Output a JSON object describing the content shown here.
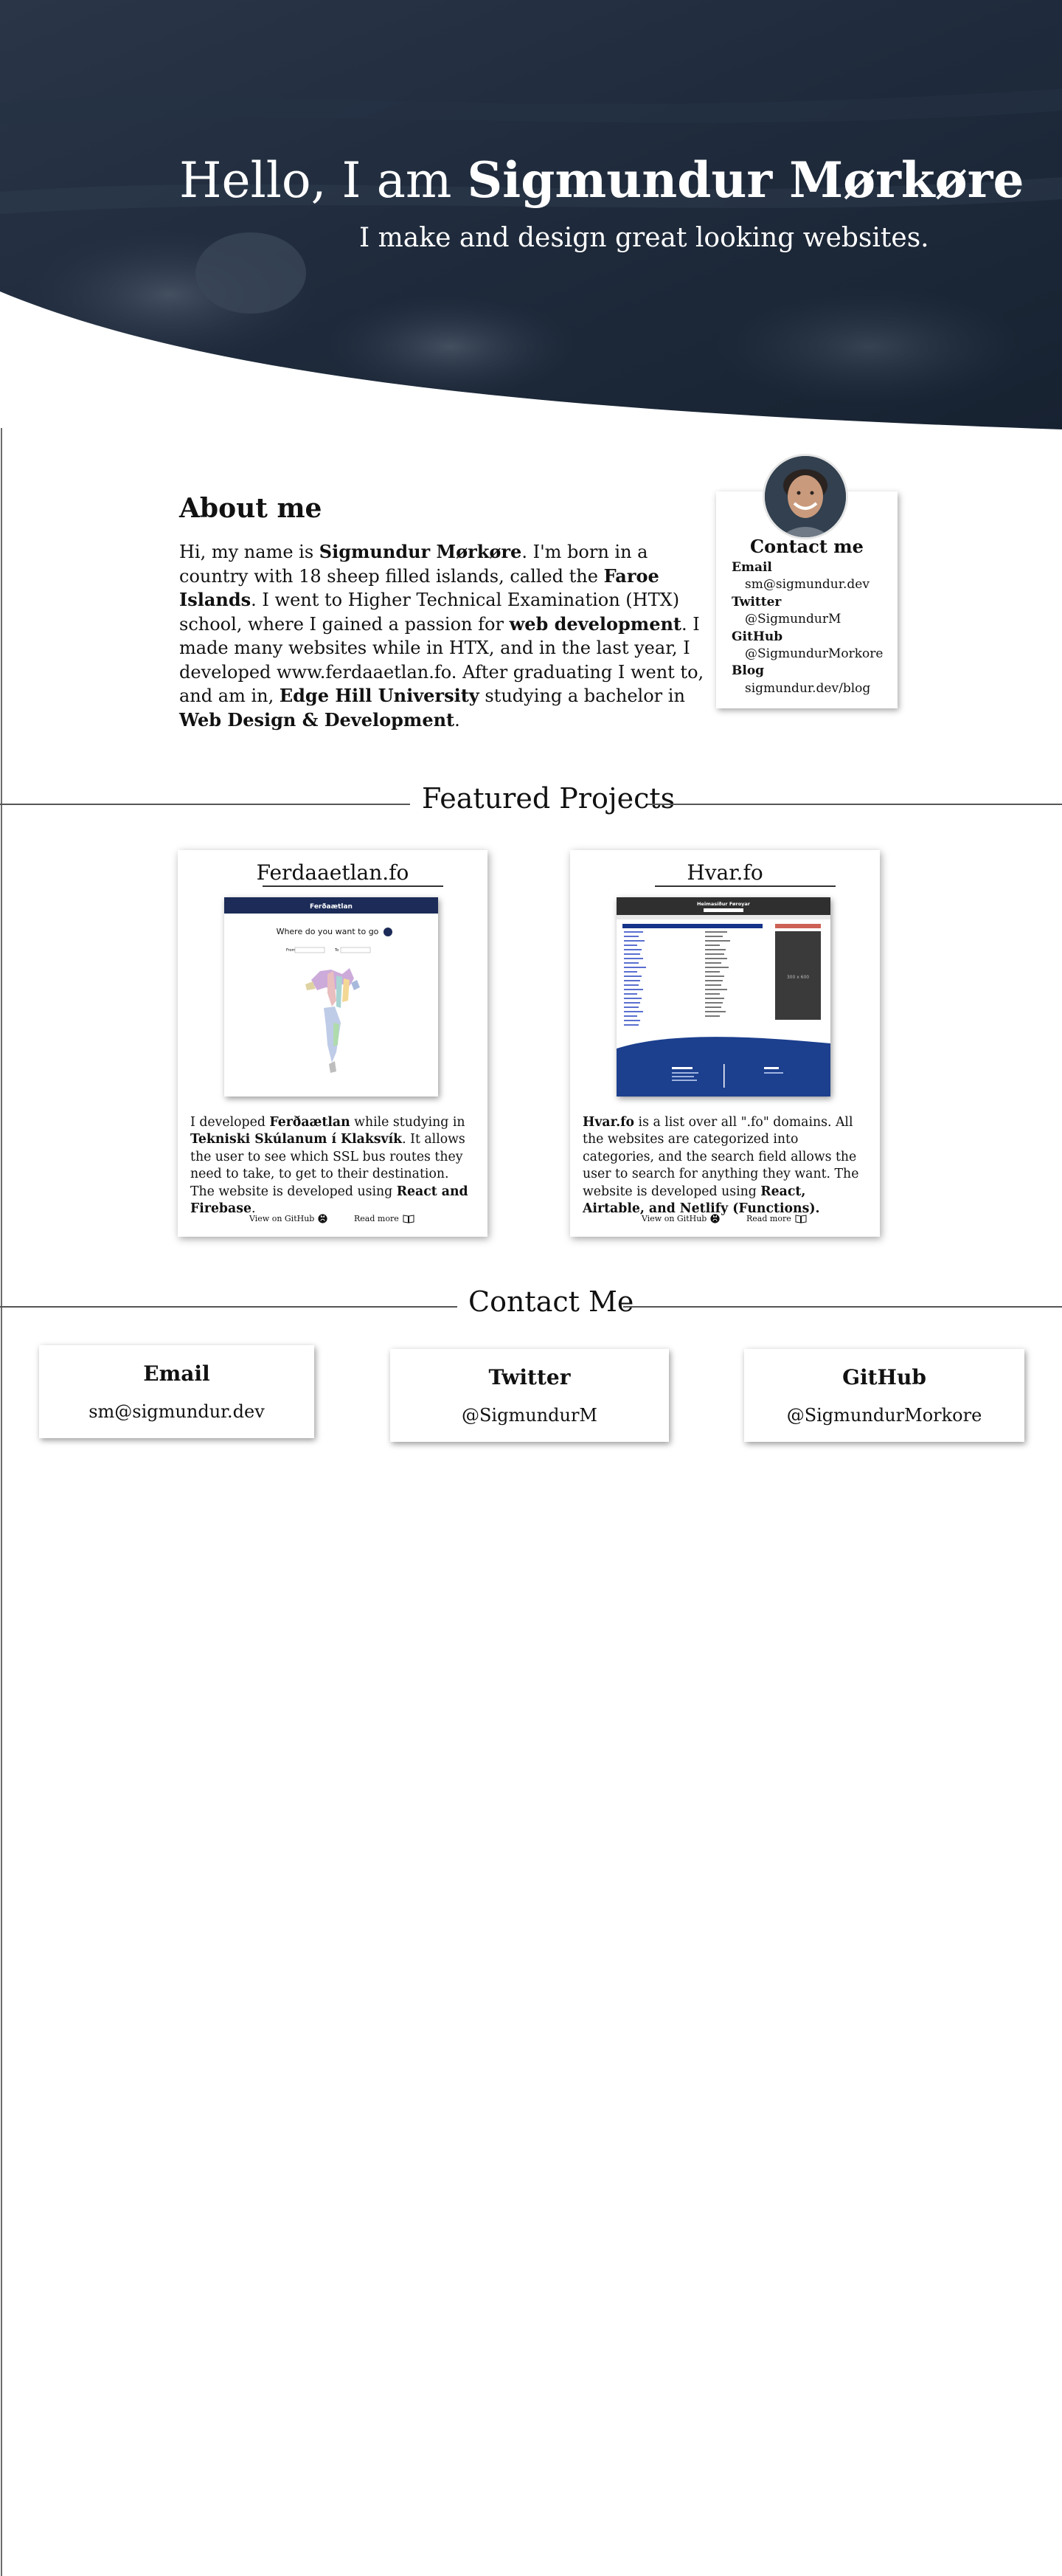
{
  "hero": {
    "greeting": "Hello, I am ",
    "name": "Sigmundur Mørkøre",
    "subtitle": "I make and design great looking websites."
  },
  "about": {
    "heading": "About me",
    "paragraph": [
      {
        "t": "Hi, my name is "
      },
      {
        "t": "Sigmundur Mørkøre",
        "b": true
      },
      {
        "t": ". I'm born in a country with 18 sheep filled islands, called the "
      },
      {
        "t": "Faroe Islands",
        "b": true
      },
      {
        "t": ". I went to Higher Technical Examination (HTX) school, where I gained a passion for "
      },
      {
        "t": "web development",
        "b": true
      },
      {
        "t": ". I made many websites while in HTX, and in the last year, I developed www.ferdaaetlan.fo. After graduating I went to, and am in, "
      },
      {
        "t": "Edge Hill University",
        "b": true
      },
      {
        "t": " studying a bachelor in "
      },
      {
        "t": "Web Design & Development",
        "b": true
      },
      {
        "t": "."
      }
    ]
  },
  "contact_card": {
    "title": "Contact me",
    "items": [
      {
        "label": "Email",
        "value": "sm@sigmundur.dev"
      },
      {
        "label": "Twitter",
        "value": "@SigmundurM"
      },
      {
        "label": "GitHub",
        "value": "@SigmundurMorkore"
      },
      {
        "label": "Blog",
        "value": "sigmundur.dev/blog"
      }
    ]
  },
  "projects": {
    "heading": "Featured Projects",
    "items": [
      {
        "title": "Ferdaaetlan.fo",
        "desc": [
          {
            "t": "I developed "
          },
          {
            "t": "Ferðaætlan",
            "b": true
          },
          {
            "t": " while studying in "
          },
          {
            "t": "Tekniski Skúlanum í Klaksvík",
            "b": true
          },
          {
            "t": ". It allows the user to see which SSL bus routes they need to take, to get to their destination. The website is developed using "
          },
          {
            "t": "React and Firebase",
            "b": true
          },
          {
            "t": "."
          }
        ],
        "github_label": "View on GitHub",
        "read_label": "Read more",
        "shot": {
          "header": "Ferðaætlan",
          "question": "Where do you want to go",
          "from_label": "From",
          "to_label": "To"
        }
      },
      {
        "title": "Hvar.fo",
        "desc": [
          {
            "t": "Hvar.fo",
            "b": true
          },
          {
            "t": " is a list over all \".fo\" domains. All the websites are categorized into categories, and the search field allows the user to search for anything they want. The website is developed using "
          },
          {
            "t": "React, Airtable, and Netlify (Functions).",
            "b": true
          }
        ],
        "github_label": "View on GitHub",
        "read_label": "Read more",
        "shot": {
          "header": "Heimasíður Føroyar",
          "ad_label": "300 x 600"
        }
      }
    ]
  },
  "contact": {
    "heading": "Contact Me",
    "boxes": [
      {
        "title": "Email",
        "value": "sm@sigmundur.dev"
      },
      {
        "title": "Twitter",
        "value": "@SigmundurM"
      },
      {
        "title": "GitHub",
        "value": "@SigmundurMorkore"
      }
    ]
  },
  "colors": {
    "hero_dark": "#1b2637",
    "accent_blue": "#163a78",
    "rule": "#555555"
  }
}
